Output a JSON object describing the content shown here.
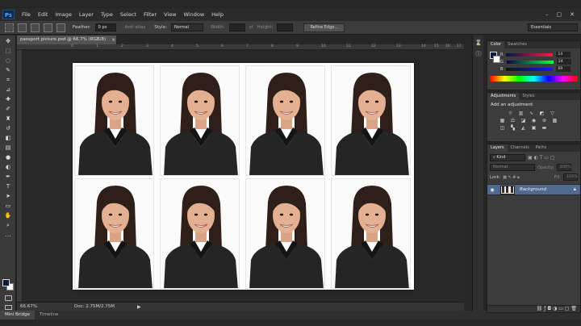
{
  "app": {
    "logo": "Ps"
  },
  "menu": [
    "File",
    "Edit",
    "Image",
    "Layer",
    "Type",
    "Select",
    "Filter",
    "View",
    "Window",
    "Help"
  ],
  "window_controls": [
    "–",
    "▢",
    "✕"
  ],
  "options": {
    "feather_label": "Feather:",
    "feather_value": "0 px",
    "antialias_label": "Anti-alias",
    "style_label": "Style:",
    "style_value": "Normal",
    "width_label": "Width:",
    "height_label": "Height:",
    "refine_label": "Refine Edge...",
    "workspace": "Essentials"
  },
  "document": {
    "tab_title": "passport picture.psd @ 66.7% (RGB/8)",
    "tab_close": "×",
    "ruler_numbers": [
      "0",
      "1",
      "2",
      "3",
      "4",
      "5",
      "6",
      "7",
      "8",
      "9",
      "10",
      "11",
      "12",
      "13",
      "14",
      "15",
      "16",
      "17"
    ],
    "photo_rows": 2,
    "photo_cols": 4
  },
  "status": {
    "zoom": "66.67%",
    "doc": "Doc: 2.75M/2.75M"
  },
  "bottom_tabs": [
    "Mini Bridge",
    "Timeline"
  ],
  "color_panel": {
    "tabs": [
      "Color",
      "Swatches"
    ],
    "channels": [
      {
        "label": "R",
        "value": "14"
      },
      {
        "label": "G",
        "value": "24"
      },
      {
        "label": "B",
        "value": "69"
      }
    ],
    "fg_color": "#0e1845"
  },
  "adjustments_panel": {
    "tabs": [
      "Adjustments",
      "Styles"
    ],
    "heading": "Add an adjustment"
  },
  "layers_panel": {
    "tabs": [
      "Layers",
      "Channels",
      "Paths"
    ],
    "kind_label": "Kind",
    "blend_mode": "Normal",
    "opacity_label": "Opacity:",
    "opacity_value": "100%",
    "lock_label": "Lock:",
    "fill_label": "Fill:",
    "fill_value": "100%",
    "layer_name": "Background"
  }
}
